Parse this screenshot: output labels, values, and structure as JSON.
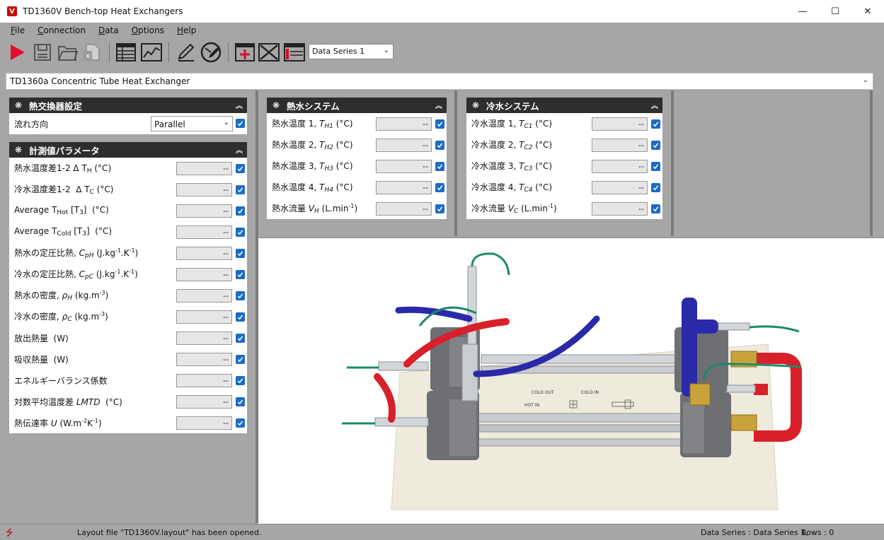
{
  "window": {
    "title": "TD1360V Bench-top Heat Exchangers",
    "logo_letter": "V",
    "minimize": "—",
    "maximize": "☐",
    "close": "✕"
  },
  "menu": [
    {
      "label": "File",
      "access": "F",
      "rest": "ile"
    },
    {
      "label": "Connection",
      "access": "C",
      "rest": "onnection"
    },
    {
      "label": "Data",
      "access": "D",
      "rest": "ata"
    },
    {
      "label": "Options",
      "access": "O",
      "rest": "ptions"
    },
    {
      "label": "Help",
      "access": "H",
      "rest": "elp"
    }
  ],
  "toolbar": {
    "series_select_value": "Data Series 1"
  },
  "equipment_select_value": "TD1360a Concentric Tube Heat Exchanger",
  "settings_panel": {
    "title": "熱交換器設定",
    "flow_label": "流れ方向",
    "flow_value": "Parallel"
  },
  "measured_panel": {
    "title": "計測値パラメータ",
    "empty_value": "--"
  },
  "hot_panel": {
    "title": "熱水システム",
    "empty_value": "--",
    "rows": [
      {
        "label": "熱水温度 1, ",
        "sym": "T",
        "sub": "H1",
        "unit": " (°C)"
      },
      {
        "label": "熱水温度 2, ",
        "sym": "T",
        "sub": "H2",
        "unit": " (°C)"
      },
      {
        "label": "熱水温度 3, ",
        "sym": "T",
        "sub": "H3",
        "unit": " (°C)"
      },
      {
        "label": "熱水温度 4, ",
        "sym": "T",
        "sub": "H4",
        "unit": " (°C)"
      },
      {
        "label": "熱水流量 ",
        "sym": "V",
        "sub": "H",
        "unit": " (L.min",
        "sup": "-1",
        "tail": ")"
      }
    ]
  },
  "cold_panel": {
    "title": "冷水システム",
    "empty_value": "--",
    "rows": [
      {
        "label": "冷水温度 1, ",
        "sym": "T",
        "sub": "C1",
        "unit": " (°C)"
      },
      {
        "label": "冷水温度 2, ",
        "sym": "T",
        "sub": "C2",
        "unit": " (°C)"
      },
      {
        "label": "冷水温度 3, ",
        "sym": "T",
        "sub": "C3",
        "unit": " (°C)"
      },
      {
        "label": "冷水温度 4, ",
        "sym": "T",
        "sub": "C4",
        "unit": " (°C)"
      },
      {
        "label": "冷水流量 ",
        "sym": "V",
        "sub": "C",
        "unit": " (L.min",
        "sup": "-1",
        "tail": ")"
      }
    ]
  },
  "diagram": {
    "label_cold_out": "COLD OUT",
    "label_cold_in": "COLD IN",
    "label_hot_in": "HOT IN",
    "colors": {
      "hot": "#d8202a",
      "cold": "#2a2aa8",
      "sensor_wire": "#1a8a6a",
      "steel": "#c9ccd0",
      "housing": "#6e6f72",
      "brass": "#c9a33a"
    }
  },
  "status": {
    "usb_icon": "usb-icon",
    "message": "Layout file \"TD1360V.layout\" has been opened.",
    "data_series_text": "Data Series : Data Series 1,",
    "rows_text": "Rows : 0"
  }
}
